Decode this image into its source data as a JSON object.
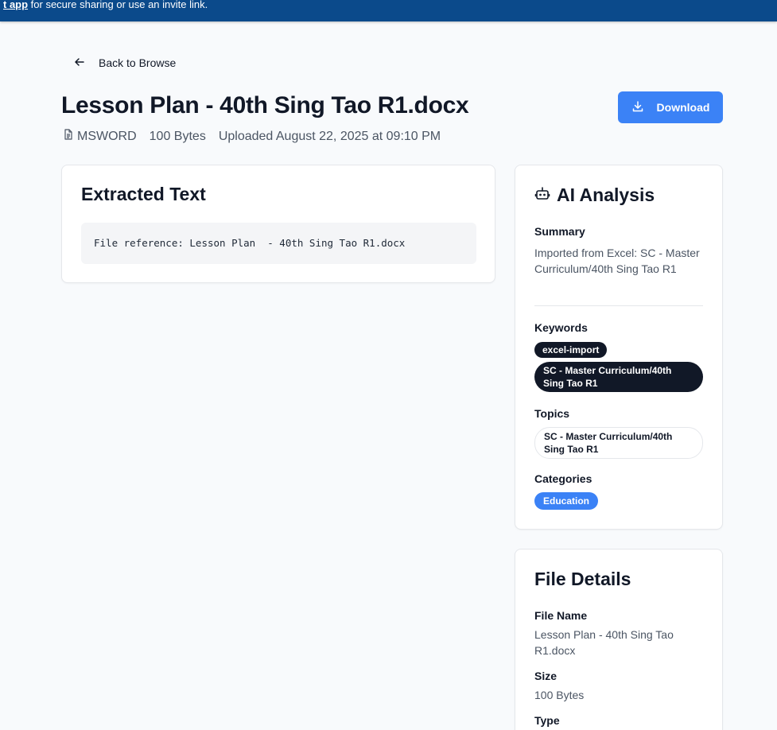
{
  "banner": {
    "link_text": "t app",
    "text": " for secure sharing or use an invite link."
  },
  "nav": {
    "back_label": "Back to Browse",
    "back_icon": "arrow-left-icon"
  },
  "file": {
    "title": "Lesson Plan - 40th Sing Tao R1.docx",
    "type": "MSWORD",
    "size": "100 Bytes",
    "uploaded": "Uploaded August 22, 2025 at 09:10 PM"
  },
  "actions": {
    "download_label": "Download",
    "download_icon": "download-icon"
  },
  "extracted": {
    "heading": "Extracted Text",
    "text": "File reference: Lesson Plan  - 40th Sing Tao R1.docx"
  },
  "ai": {
    "heading": "AI Analysis",
    "icon": "bot-icon",
    "summary_label": "Summary",
    "summary": "Imported from Excel: SC - Master Curriculum/40th Sing Tao R1",
    "keywords_label": "Keywords",
    "keywords": [
      "excel-import",
      "SC - Master Curriculum/40th Sing Tao R1"
    ],
    "topics_label": "Topics",
    "topics": [
      "SC - Master Curriculum/40th Sing Tao R1"
    ],
    "categories_label": "Categories",
    "categories": [
      "Education"
    ]
  },
  "details": {
    "heading": "File Details",
    "file_name_label": "File Name",
    "file_name": "Lesson Plan - 40th Sing Tao R1.docx",
    "size_label": "Size",
    "size": "100 Bytes",
    "type_label": "Type"
  },
  "colors": {
    "accent": "#3b82f6",
    "banner": "#0b4a8b",
    "badge_dark": "#111827"
  }
}
